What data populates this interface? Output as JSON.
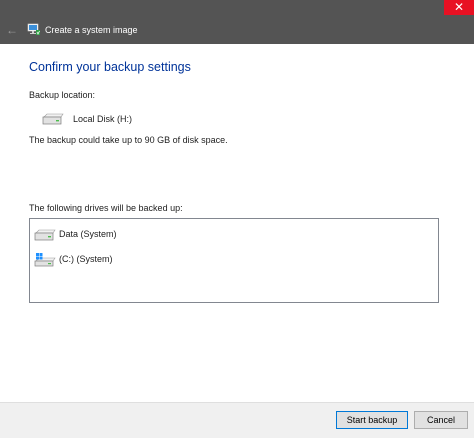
{
  "window": {
    "title": "Create a system image",
    "back_icon": "back-arrow-icon",
    "close_icon": "close-icon",
    "close_glyph": "✕",
    "back_glyph": "←"
  },
  "main": {
    "heading": "Confirm your backup settings",
    "backup_location_label": "Backup location:",
    "backup_location": {
      "name": "Local Disk (H:)",
      "icon": "hard-drive-icon"
    },
    "space_note": "The backup could take up to 90 GB of disk space.",
    "drives_label": "The following drives will be backed up:",
    "drives": [
      {
        "name": "Data (System)",
        "icon": "hard-drive-icon"
      },
      {
        "name": "(C:) (System)",
        "icon": "windows-drive-icon"
      }
    ]
  },
  "footer": {
    "start_label": "Start backup",
    "cancel_label": "Cancel"
  },
  "colors": {
    "titlebar": "#545454",
    "close": "#e81123",
    "heading": "#003399",
    "primary_border": "#0078d7"
  }
}
